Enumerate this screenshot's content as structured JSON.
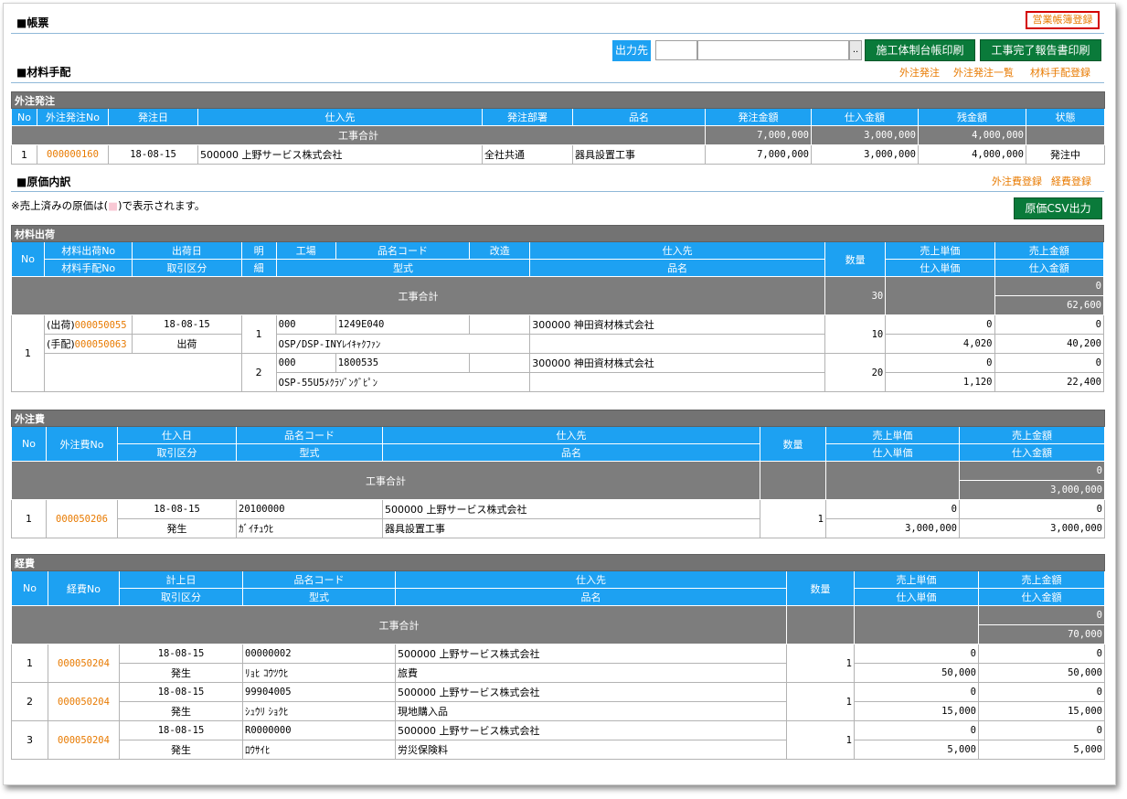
{
  "top": {
    "title": "■帳票",
    "register_link": "営業帳簿登録",
    "output_label": "出力先",
    "output_value": "",
    "browse": "..",
    "print1": "施工体制台帳印刷",
    "print2": "工事完了報告書印刷"
  },
  "material_header": {
    "title": "■材料手配",
    "links": [
      "外注発注",
      "外注発注一覧",
      "材料手配登録"
    ]
  },
  "order": {
    "title": "外注発注",
    "headers": [
      "No",
      "外注発注No",
      "発注日",
      "仕入先",
      "発注部署",
      "品名",
      "発注金額",
      "仕入金額",
      "残金額",
      "状態"
    ],
    "total": {
      "label": "工事合計",
      "order_amount": "7,000,000",
      "purchase_amount": "3,000,000",
      "remaining": "4,000,000"
    },
    "rows": [
      {
        "no": "1",
        "order_no": "000000160",
        "date": "18-08-15",
        "supplier": "500000 上野サービス株式会社",
        "dept": "全社共通",
        "item": "器具設置工事",
        "order_amount": "7,000,000",
        "purchase_amount": "3,000,000",
        "remaining": "4,000,000",
        "status": "発注中"
      }
    ]
  },
  "cost_header": {
    "title": "■原価内訳",
    "links": [
      "外注費登録",
      "経費登録"
    ],
    "note_pre": "※売上済みの原価は(",
    "note_mark": "■",
    "note_post": ")で表示されます。",
    "csv_button": "原価CSV出力"
  },
  "material": {
    "title": "材料出荷",
    "headers1": [
      "No",
      "材料出荷No",
      "出荷日",
      "明",
      "工場",
      "品名コード",
      "改造",
      "仕入先",
      "数量",
      "売上単価",
      "売上金額"
    ],
    "headers2": [
      "材料手配No",
      "取引区分",
      "細",
      "型式",
      "品名",
      "仕入単価",
      "仕入金額"
    ],
    "total": {
      "label": "工事合計",
      "qty": "30",
      "sales": "0",
      "purchase": "62,600"
    },
    "row": {
      "no": "1",
      "ship_prefix": "(出荷)",
      "ship_no": "000050055",
      "date": "18-08-15",
      "arr_prefix": "(手配)",
      "arr_no": "000050063",
      "type": "出荷"
    },
    "details": [
      {
        "line": "1",
        "factory": "000",
        "code": "1249E040",
        "supplier": "300000 神田資材株式会社",
        "model": "OSP/DSP-INYﾚｲｷｬｸﾌｧﾝ",
        "qty": "10",
        "sale_unit": "0",
        "sale_amt": "0",
        "pur_unit": "4,020",
        "pur_amt": "40,200"
      },
      {
        "line": "2",
        "factory": "000",
        "code": "1800535",
        "supplier": "300000 神田資材株式会社",
        "model": "OSP-55U5ﾒｸﾗｿﾞﾝｸﾞﾋﾟﾝ",
        "qty": "20",
        "sale_unit": "0",
        "sale_amt": "0",
        "pur_unit": "1,120",
        "pur_amt": "22,400"
      }
    ]
  },
  "outsource": {
    "title": "外注費",
    "headers1": [
      "No",
      "外注費No",
      "仕入日",
      "品名コード",
      "仕入先",
      "数量",
      "売上単価",
      "売上金額"
    ],
    "headers2": [
      "取引区分",
      "型式",
      "品名",
      "仕入単価",
      "仕入金額"
    ],
    "total": {
      "label": "工事合計",
      "sales": "0",
      "purchase": "3,000,000"
    },
    "rows": [
      {
        "no": "1",
        "id": "000050206",
        "date": "18-08-15",
        "type": "発生",
        "code": "20100000",
        "model": "ｶﾞｲﾁｭｳﾋ",
        "supplier": "500000 上野サービス株式会社",
        "item": "器具設置工事",
        "qty": "1",
        "sale_unit": "0",
        "sale_amt": "0",
        "pur_unit": "3,000,000",
        "pur_amt": "3,000,000"
      }
    ]
  },
  "expense": {
    "title": "経費",
    "headers1": [
      "No",
      "経費No",
      "計上日",
      "品名コード",
      "仕入先",
      "数量",
      "売上単価",
      "売上金額"
    ],
    "headers2": [
      "取引区分",
      "型式",
      "品名",
      "仕入単価",
      "仕入金額"
    ],
    "total": {
      "label": "工事合計",
      "sales": "0",
      "purchase": "70,000"
    },
    "rows": [
      {
        "no": "1",
        "id": "000050204",
        "date": "18-08-15",
        "type": "発生",
        "code": "00000002",
        "model": "ﾘｮﾋ ｺｳﾂｳﾋ",
        "supplier": "500000 上野サービス株式会社",
        "item": "旅費",
        "qty": "1",
        "sale_unit": "0",
        "sale_amt": "0",
        "pur_unit": "50,000",
        "pur_amt": "50,000"
      },
      {
        "no": "2",
        "id": "000050204",
        "date": "18-08-15",
        "type": "発生",
        "code": "99904005",
        "model": "ｼｭｳﾘ ｼｮｸﾋ",
        "supplier": "500000 上野サービス株式会社",
        "item": "現地購入品",
        "qty": "1",
        "sale_unit": "0",
        "sale_amt": "0",
        "pur_unit": "15,000",
        "pur_amt": "15,000"
      },
      {
        "no": "3",
        "id": "000050204",
        "date": "18-08-15",
        "type": "発生",
        "code": "R0000000",
        "model": "ﾛｳｻｲﾋ",
        "supplier": "500000 上野サービス株式会社",
        "item": "労災保険料",
        "qty": "1",
        "sale_unit": "0",
        "sale_amt": "0",
        "pur_unit": "5,000",
        "pur_amt": "5,000"
      }
    ]
  },
  "colors": {
    "header_blue": "#1da1f2",
    "bar_gray": "#737373",
    "link_orange": "#e87a00",
    "button_green": "#0a7a3a",
    "alert_red": "#d40000"
  }
}
